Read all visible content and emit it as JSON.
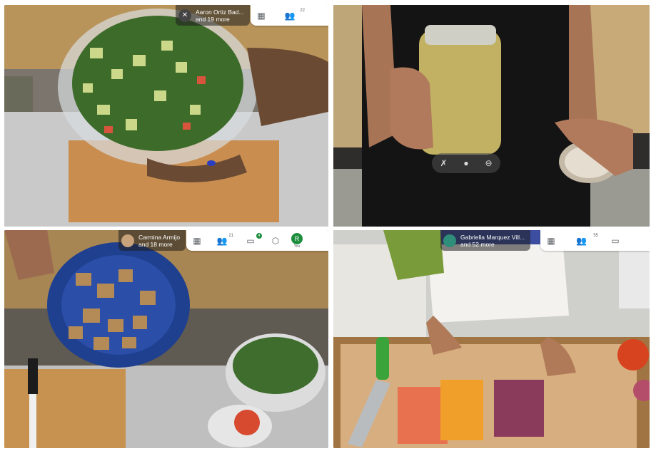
{
  "tiles": [
    {
      "host": "Aaron Ortiz Bad...",
      "others": "and 19 more",
      "participants": "22"
    },
    {
      "controls": [
        "camera-off-icon",
        "mic-icon",
        "minus-icon"
      ]
    },
    {
      "host": "Carmina Armijo",
      "others": "and 18 more",
      "participants": "21",
      "chat_count": "4",
      "self_initial": "R",
      "self_label": "You"
    },
    {
      "host": "Gabriella Marquez Vill...",
      "others": "and 52 more",
      "participants": "55"
    }
  ],
  "colors": {
    "accent_green": "#1e8e3e",
    "toolbar_bg": "#ffffff"
  }
}
